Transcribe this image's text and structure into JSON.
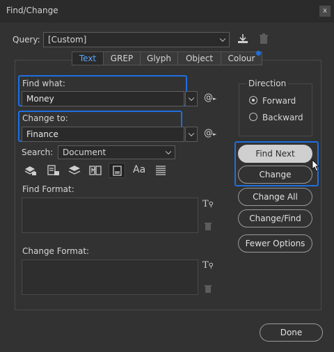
{
  "window": {
    "title": "Find/Change",
    "close_glyph": "x"
  },
  "query": {
    "label": "Query:",
    "value": "[Custom]"
  },
  "tabs": [
    {
      "label": "Text",
      "active": true
    },
    {
      "label": "GREP",
      "active": false
    },
    {
      "label": "Glyph",
      "active": false
    },
    {
      "label": "Object",
      "active": false
    },
    {
      "label": "Colour",
      "active": false
    }
  ],
  "find_what": {
    "label": "Find what:",
    "value": "Money"
  },
  "change_to": {
    "label": "Change to:",
    "value": "Finance"
  },
  "search": {
    "label": "Search:",
    "value": "Document"
  },
  "find_format": {
    "label": "Find Format:"
  },
  "change_format": {
    "label": "Change Format:"
  },
  "direction": {
    "label": "Direction",
    "options": [
      {
        "label": "Forward",
        "selected": true
      },
      {
        "label": "Backward",
        "selected": false
      }
    ]
  },
  "buttons": {
    "find_next": "Find Next",
    "change": "Change",
    "change_all": "Change All",
    "change_find": "Change/Find",
    "fewer_options": "Fewer Options",
    "done": "Done"
  },
  "colors": {
    "accent": "#1e6fe0",
    "tab_active_text": "#5aa4ff",
    "background": "#323232"
  }
}
